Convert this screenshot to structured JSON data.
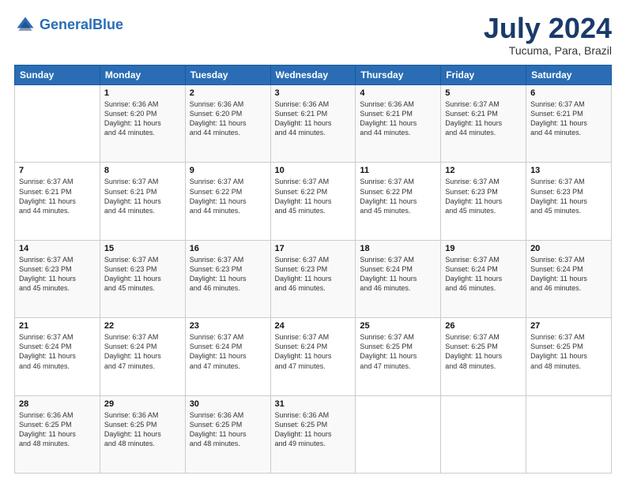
{
  "header": {
    "logo_line1": "General",
    "logo_line2": "Blue",
    "title": "July 2024",
    "subtitle": "Tucuma, Para, Brazil"
  },
  "days_of_week": [
    "Sunday",
    "Monday",
    "Tuesday",
    "Wednesday",
    "Thursday",
    "Friday",
    "Saturday"
  ],
  "weeks": [
    [
      {
        "day": "",
        "info": ""
      },
      {
        "day": "1",
        "info": "Sunrise: 6:36 AM\nSunset: 6:20 PM\nDaylight: 11 hours\nand 44 minutes."
      },
      {
        "day": "2",
        "info": "Sunrise: 6:36 AM\nSunset: 6:20 PM\nDaylight: 11 hours\nand 44 minutes."
      },
      {
        "day": "3",
        "info": "Sunrise: 6:36 AM\nSunset: 6:21 PM\nDaylight: 11 hours\nand 44 minutes."
      },
      {
        "day": "4",
        "info": "Sunrise: 6:36 AM\nSunset: 6:21 PM\nDaylight: 11 hours\nand 44 minutes."
      },
      {
        "day": "5",
        "info": "Sunrise: 6:37 AM\nSunset: 6:21 PM\nDaylight: 11 hours\nand 44 minutes."
      },
      {
        "day": "6",
        "info": "Sunrise: 6:37 AM\nSunset: 6:21 PM\nDaylight: 11 hours\nand 44 minutes."
      }
    ],
    [
      {
        "day": "7",
        "info": "Sunrise: 6:37 AM\nSunset: 6:21 PM\nDaylight: 11 hours\nand 44 minutes."
      },
      {
        "day": "8",
        "info": "Sunrise: 6:37 AM\nSunset: 6:21 PM\nDaylight: 11 hours\nand 44 minutes."
      },
      {
        "day": "9",
        "info": "Sunrise: 6:37 AM\nSunset: 6:22 PM\nDaylight: 11 hours\nand 44 minutes."
      },
      {
        "day": "10",
        "info": "Sunrise: 6:37 AM\nSunset: 6:22 PM\nDaylight: 11 hours\nand 45 minutes."
      },
      {
        "day": "11",
        "info": "Sunrise: 6:37 AM\nSunset: 6:22 PM\nDaylight: 11 hours\nand 45 minutes."
      },
      {
        "day": "12",
        "info": "Sunrise: 6:37 AM\nSunset: 6:23 PM\nDaylight: 11 hours\nand 45 minutes."
      },
      {
        "day": "13",
        "info": "Sunrise: 6:37 AM\nSunset: 6:23 PM\nDaylight: 11 hours\nand 45 minutes."
      }
    ],
    [
      {
        "day": "14",
        "info": "Sunrise: 6:37 AM\nSunset: 6:23 PM\nDaylight: 11 hours\nand 45 minutes."
      },
      {
        "day": "15",
        "info": "Sunrise: 6:37 AM\nSunset: 6:23 PM\nDaylight: 11 hours\nand 45 minutes."
      },
      {
        "day": "16",
        "info": "Sunrise: 6:37 AM\nSunset: 6:23 PM\nDaylight: 11 hours\nand 46 minutes."
      },
      {
        "day": "17",
        "info": "Sunrise: 6:37 AM\nSunset: 6:23 PM\nDaylight: 11 hours\nand 46 minutes."
      },
      {
        "day": "18",
        "info": "Sunrise: 6:37 AM\nSunset: 6:24 PM\nDaylight: 11 hours\nand 46 minutes."
      },
      {
        "day": "19",
        "info": "Sunrise: 6:37 AM\nSunset: 6:24 PM\nDaylight: 11 hours\nand 46 minutes."
      },
      {
        "day": "20",
        "info": "Sunrise: 6:37 AM\nSunset: 6:24 PM\nDaylight: 11 hours\nand 46 minutes."
      }
    ],
    [
      {
        "day": "21",
        "info": "Sunrise: 6:37 AM\nSunset: 6:24 PM\nDaylight: 11 hours\nand 46 minutes."
      },
      {
        "day": "22",
        "info": "Sunrise: 6:37 AM\nSunset: 6:24 PM\nDaylight: 11 hours\nand 47 minutes."
      },
      {
        "day": "23",
        "info": "Sunrise: 6:37 AM\nSunset: 6:24 PM\nDaylight: 11 hours\nand 47 minutes."
      },
      {
        "day": "24",
        "info": "Sunrise: 6:37 AM\nSunset: 6:24 PM\nDaylight: 11 hours\nand 47 minutes."
      },
      {
        "day": "25",
        "info": "Sunrise: 6:37 AM\nSunset: 6:25 PM\nDaylight: 11 hours\nand 47 minutes."
      },
      {
        "day": "26",
        "info": "Sunrise: 6:37 AM\nSunset: 6:25 PM\nDaylight: 11 hours\nand 48 minutes."
      },
      {
        "day": "27",
        "info": "Sunrise: 6:37 AM\nSunset: 6:25 PM\nDaylight: 11 hours\nand 48 minutes."
      }
    ],
    [
      {
        "day": "28",
        "info": "Sunrise: 6:36 AM\nSunset: 6:25 PM\nDaylight: 11 hours\nand 48 minutes."
      },
      {
        "day": "29",
        "info": "Sunrise: 6:36 AM\nSunset: 6:25 PM\nDaylight: 11 hours\nand 48 minutes."
      },
      {
        "day": "30",
        "info": "Sunrise: 6:36 AM\nSunset: 6:25 PM\nDaylight: 11 hours\nand 48 minutes."
      },
      {
        "day": "31",
        "info": "Sunrise: 6:36 AM\nSunset: 6:25 PM\nDaylight: 11 hours\nand 49 minutes."
      },
      {
        "day": "",
        "info": ""
      },
      {
        "day": "",
        "info": ""
      },
      {
        "day": "",
        "info": ""
      }
    ]
  ]
}
